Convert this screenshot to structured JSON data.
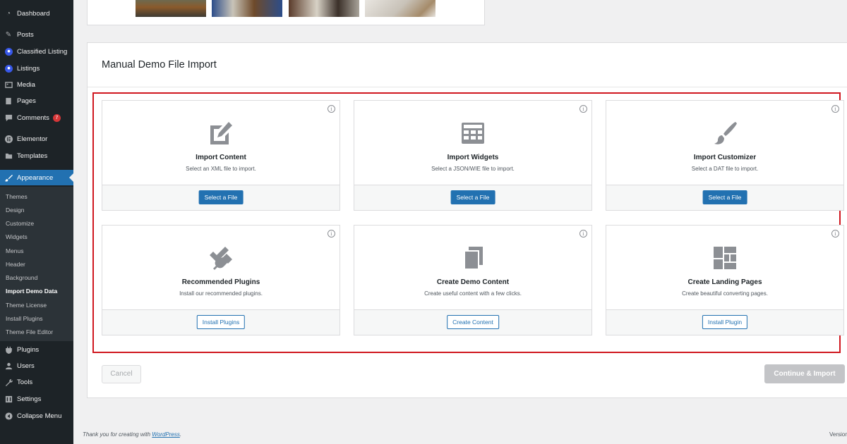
{
  "sidebar": {
    "menu": [
      {
        "label": "Dashboard",
        "icon": "dashboard-icon"
      },
      {
        "label": "Posts",
        "icon": "pin-icon"
      },
      {
        "label": "Classified Listing",
        "icon": "location-pin-icon"
      },
      {
        "label": "Listings",
        "icon": "location-pin-icon"
      },
      {
        "label": "Media",
        "icon": "media-icon"
      },
      {
        "label": "Pages",
        "icon": "page-icon"
      },
      {
        "label": "Comments",
        "icon": "comment-icon",
        "badge": "7"
      },
      {
        "label": "Elementor",
        "icon": "elementor-icon"
      },
      {
        "label": "Templates",
        "icon": "folder-icon"
      },
      {
        "label": "Appearance",
        "icon": "paintbrush-icon"
      },
      {
        "label": "Plugins",
        "icon": "plug-icon"
      },
      {
        "label": "Users",
        "icon": "user-icon"
      },
      {
        "label": "Tools",
        "icon": "wrench-icon"
      },
      {
        "label": "Settings",
        "icon": "settings-icon"
      },
      {
        "label": "Collapse Menu",
        "icon": "collapse-icon"
      }
    ],
    "submenu": [
      {
        "label": "Themes"
      },
      {
        "label": "Design"
      },
      {
        "label": "Customize"
      },
      {
        "label": "Widgets"
      },
      {
        "label": "Menus"
      },
      {
        "label": "Header"
      },
      {
        "label": "Background"
      },
      {
        "label": "Import Demo Data",
        "current": true
      },
      {
        "label": "Theme License"
      },
      {
        "label": "Install Plugins"
      },
      {
        "label": "Theme File Editor"
      }
    ]
  },
  "panel": {
    "title": "Manual Demo File Import",
    "cards": [
      {
        "title": "Import Content",
        "desc": "Select an XML file to import.",
        "button": "Select a File",
        "icon": "import-content-icon"
      },
      {
        "title": "Import Widgets",
        "desc": "Select a JSON/WIE file to import.",
        "button": "Select a File",
        "icon": "widgets-icon"
      },
      {
        "title": "Import Customizer",
        "desc": "Select a DAT file to import.",
        "button": "Select a File",
        "icon": "paintbrush-icon"
      },
      {
        "title": "Recommended Plugins",
        "desc": "Install our recommended plugins.",
        "button": "Install Plugins",
        "icon": "plugin-icon"
      },
      {
        "title": "Create Demo Content",
        "desc": "Create useful content with a few clicks.",
        "button": "Create Content",
        "icon": "copy-icon"
      },
      {
        "title": "Create Landing Pages",
        "desc": "Create beautiful converting pages.",
        "button": "Install Plugin",
        "icon": "layout-icon"
      }
    ],
    "info_glyph": "i",
    "cancel_label": "Cancel",
    "continue_label": "Continue & Import"
  },
  "footer": {
    "text": "Thank you for creating with ",
    "link": "WordPress",
    "suffix": ".",
    "version": "Version"
  },
  "colors": {
    "sidebar_bg": "#1d2327",
    "accent": "#2271b1",
    "highlight": "#d0171f",
    "badge": "#d63638"
  }
}
